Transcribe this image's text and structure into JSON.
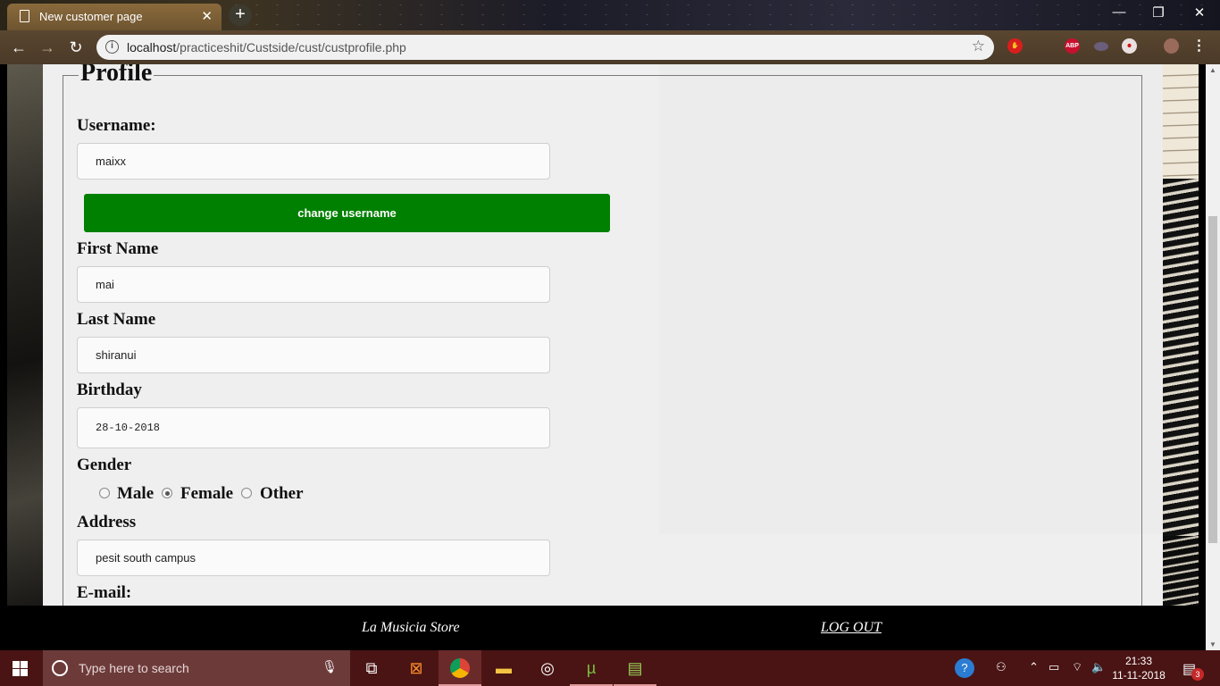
{
  "browser": {
    "tab_title": "New customer page",
    "tab_close": "✕",
    "new_tab": "+",
    "url_host": "localhost",
    "url_path": "/practiceshit/Custside/cust/custprofile.php",
    "window_controls": {
      "minimize": "—",
      "restore": "❐",
      "close": "✕"
    }
  },
  "profile": {
    "legend": "Profile",
    "username_label": "Username:",
    "username_value": "maixx",
    "change_username_button": "change username",
    "first_name_label": "First Name",
    "first_name_value": "mai",
    "last_name_label": "Last Name",
    "last_name_value": "shiranui",
    "birthday_label": "Birthday",
    "birthday_value": "28-10-2018",
    "gender_label": "Gender",
    "gender_options": [
      "Male",
      "Female",
      "Other"
    ],
    "gender_selected": "Female",
    "address_label": "Address",
    "address_value": "pesit south campus",
    "email_label": "E-mail:"
  },
  "footer": {
    "brand": "La Musicia Store",
    "logout": "LOG OUT"
  },
  "taskbar": {
    "search_placeholder": "Type here to search",
    "time": "21:33",
    "date": "11-11-2018",
    "notification_count": "3"
  },
  "colors": {
    "button_green": "#008000",
    "taskbar": "#4a1414",
    "panel": "#efefef"
  }
}
